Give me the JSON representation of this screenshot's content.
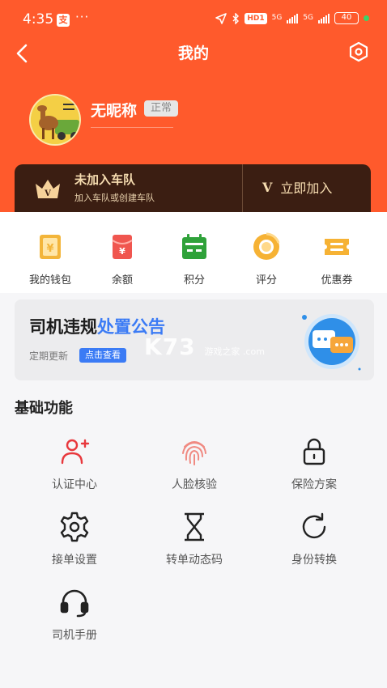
{
  "status_bar": {
    "time": "4:35",
    "alipay_glyph": "支",
    "more": "···",
    "hd_label": "HD1",
    "net1": "5G",
    "net2": "5G",
    "battery": "40"
  },
  "nav": {
    "title": "我的",
    "back_icon": "chevron-left-icon",
    "settings_icon": "hexagon-settings-icon"
  },
  "profile": {
    "nickname": "无昵称",
    "status": "正常"
  },
  "team": {
    "title": "未加入车队",
    "subtitle": "加入车队或创建车队",
    "join_prefix": "V",
    "join_label": "立即加入"
  },
  "quick_menu": [
    {
      "label": "我的钱包",
      "icon": "wallet-icon",
      "color": "#f3b53a"
    },
    {
      "label": "余额",
      "icon": "red-packet-icon",
      "color": "#f0564f"
    },
    {
      "label": "积分",
      "icon": "calendar-icon",
      "color": "#2fa23a"
    },
    {
      "label": "评分",
      "icon": "rating-icon",
      "color": "#f6b234"
    },
    {
      "label": "优惠券",
      "icon": "coupon-icon",
      "color": "#f6b234"
    }
  ],
  "notice": {
    "title_part1": "司机违规",
    "title_part2": "处置公告",
    "subtitle": "定期更新",
    "button": "点击查看",
    "watermark_main": "K73",
    "watermark_sub": "游戏之家 .com",
    "accent": "#3b7bf5"
  },
  "basic": {
    "title": "基础功能",
    "items": [
      {
        "label": "认证中心",
        "icon": "add-user-icon"
      },
      {
        "label": "人脸核验",
        "icon": "fingerprint-icon"
      },
      {
        "label": "保险方案",
        "icon": "lock-icon"
      },
      {
        "label": "接单设置",
        "icon": "gear-icon"
      },
      {
        "label": "转单动态码",
        "icon": "hourglass-icon"
      },
      {
        "label": "身份转换",
        "icon": "refresh-icon"
      },
      {
        "label": "司机手册",
        "icon": "headset-icon"
      }
    ]
  },
  "colors": {
    "header": "#ff5a2c",
    "team_bg": "#3b1e12",
    "team_text": "#f6dcb0"
  }
}
